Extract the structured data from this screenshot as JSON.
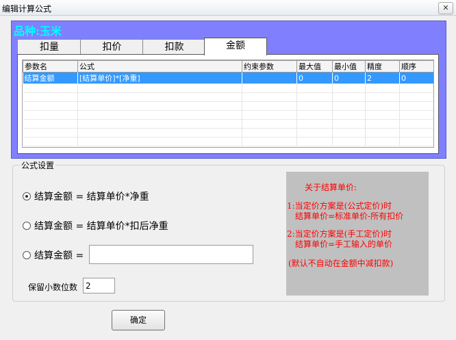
{
  "window": {
    "title": "编辑计算公式",
    "close_glyph": "✕"
  },
  "variety_label": "品种:玉米",
  "tabs": [
    "扣量",
    "扣价",
    "扣款",
    "金额"
  ],
  "active_tab": 3,
  "grid": {
    "columns": [
      "参数名",
      "公式",
      "约束参数",
      "最大值",
      "最小值",
      "精度",
      "顺序"
    ],
    "rows": [
      [
        "结算金额",
        "[结算单价]*[净重]",
        "",
        "0",
        "0",
        "2",
        "0"
      ]
    ],
    "selected_row": 0
  },
  "formula_settings": {
    "legend": "公式设置",
    "options": [
      {
        "label": "结算金额 = 结算单价*净重",
        "checked": true
      },
      {
        "label": "结算金额 = 结算单价*扣后净重",
        "checked": false
      },
      {
        "label": "结算金额 =",
        "checked": false
      }
    ],
    "custom_formula_value": "",
    "decimals_label": "保留小数位数",
    "decimals_value": "2"
  },
  "note": {
    "title": "关于结算单价:",
    "line1": "1:当定价方案是(公式定价)时",
    "line2": "结算单价=标准单价-所有扣价",
    "line3": "2:当定价方案是(手工定价)时",
    "line4": "结算单价=手工输入的单价",
    "line5": "(默认不自动在金额中减扣款)"
  },
  "ok_button": "确定",
  "colors": {
    "panel": "#8080ff",
    "variety_text": "#00ffff",
    "selection": "#3399ff",
    "note_text": "#ff0000",
    "note_bg": "#c0c0c0"
  }
}
